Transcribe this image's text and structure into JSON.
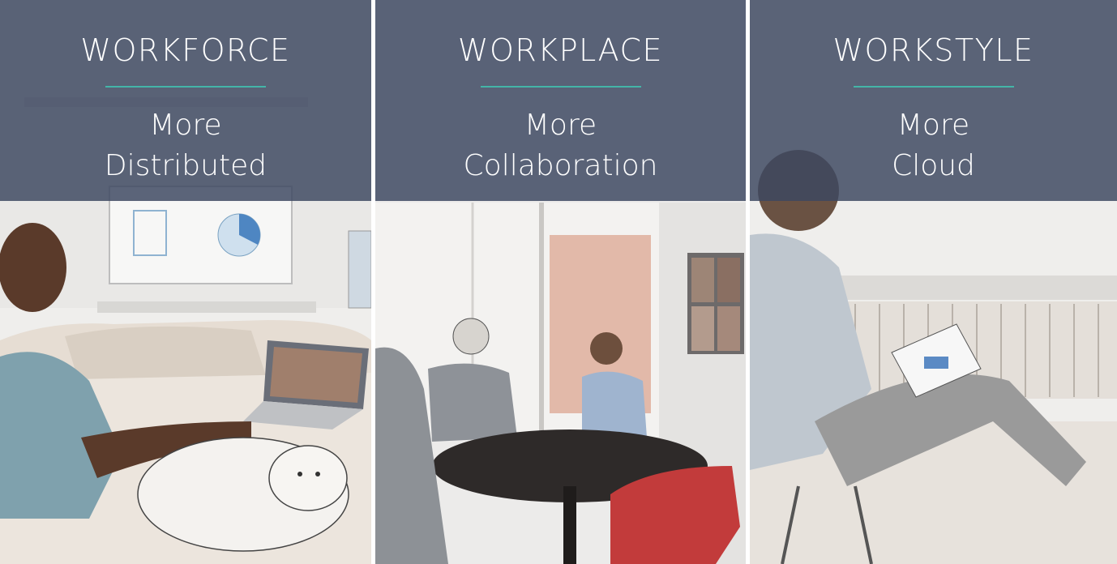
{
  "panels": [
    {
      "title": "WORKFORCE",
      "line1": "More",
      "line2": "Distributed",
      "scene": "woman on couch with laptop and dog"
    },
    {
      "title": "WORKPLACE",
      "line1": "More",
      "line2": "Collaboration",
      "scene": "meeting room with people at round table"
    },
    {
      "title": "WORKSTYLE",
      "line1": "More",
      "line2": "Cloud",
      "scene": "man on stool with tablet"
    }
  ],
  "colors": {
    "overlay": "#3d4861",
    "accent_rule": "#44b5a8",
    "text": "#ffffff"
  }
}
